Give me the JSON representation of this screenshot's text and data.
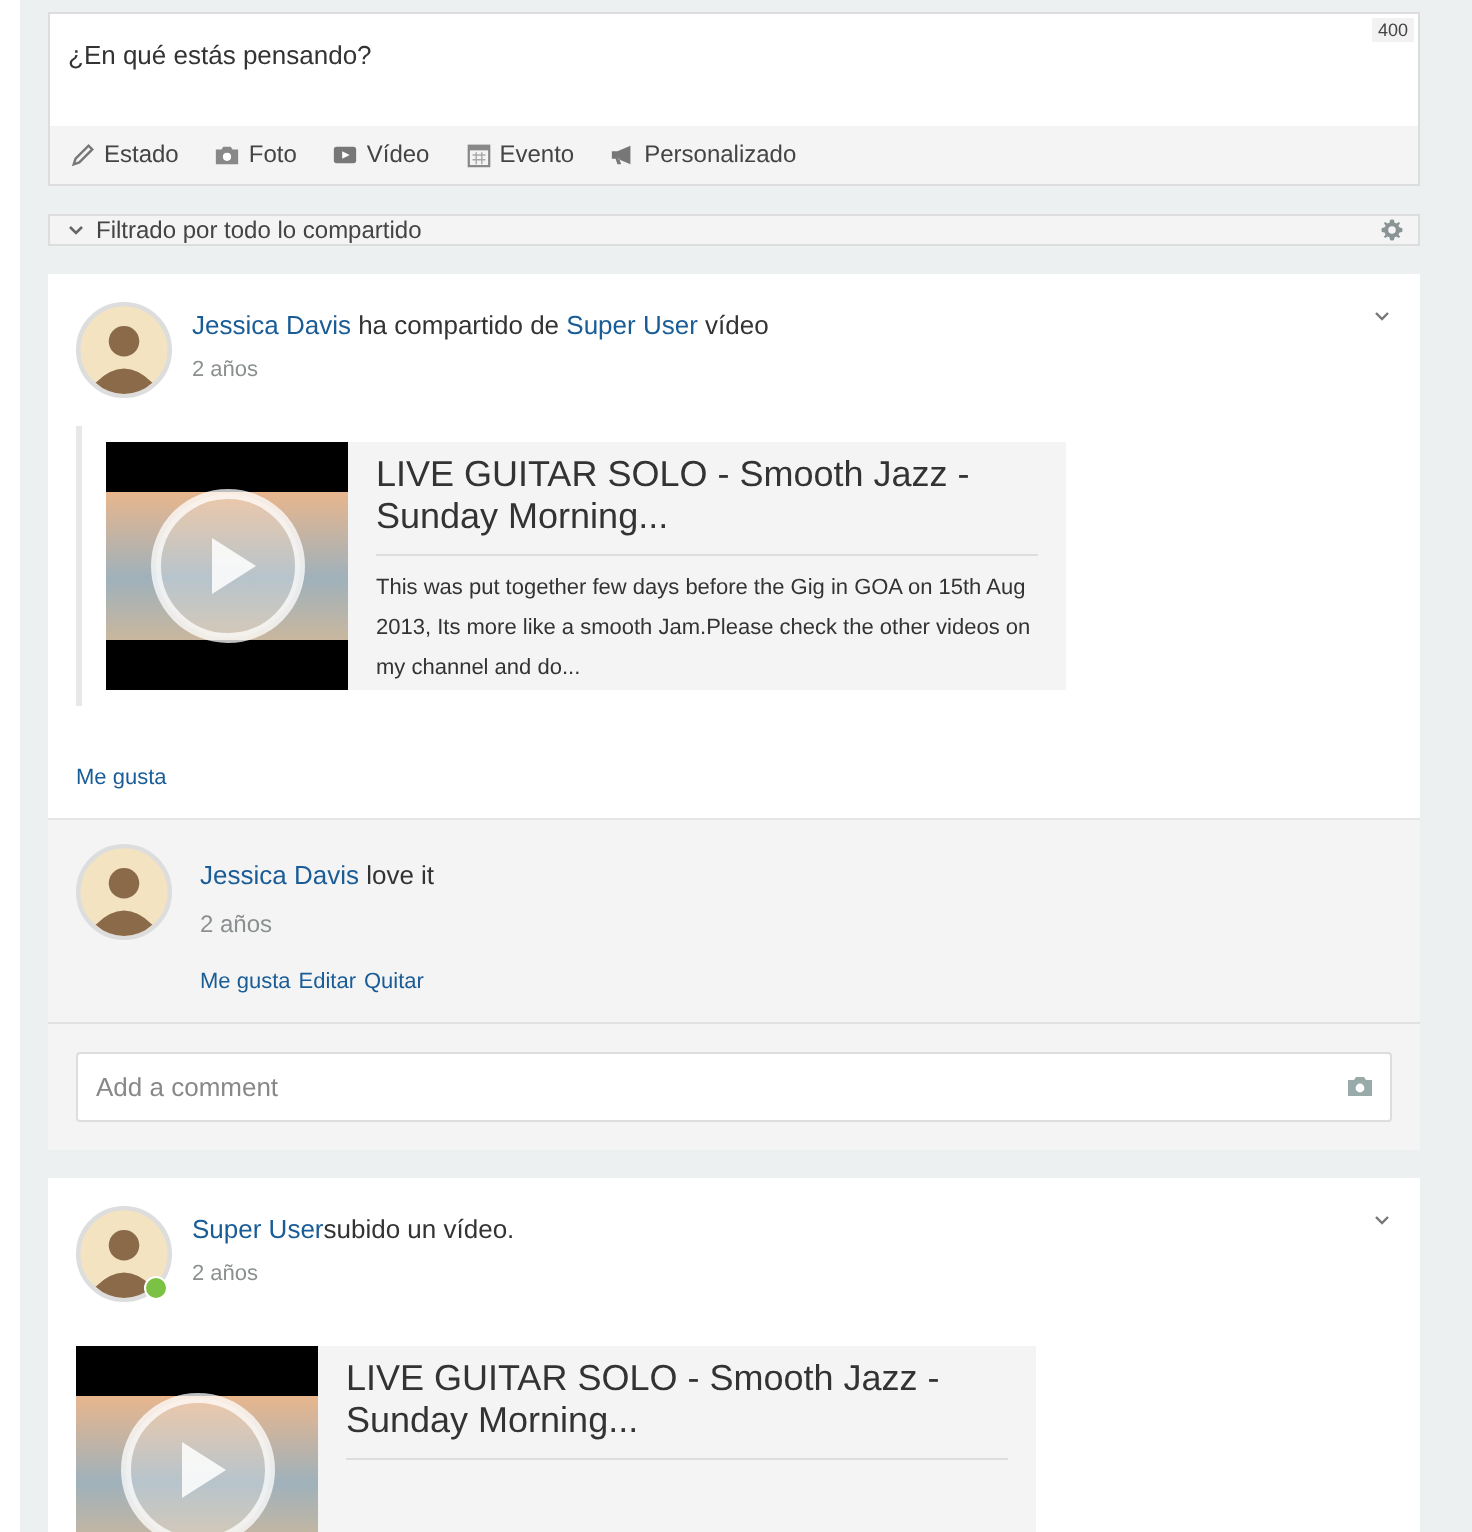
{
  "composer": {
    "placeholder": "¿En qué estás pensando?",
    "counter": "400",
    "actions": [
      {
        "kind": "status",
        "label": "Estado"
      },
      {
        "kind": "photo",
        "label": "Foto"
      },
      {
        "kind": "video",
        "label": "Vídeo"
      },
      {
        "kind": "event",
        "label": "Evento"
      },
      {
        "kind": "custom",
        "label": "Personalizado"
      }
    ]
  },
  "filter": {
    "label": "Filtrado por todo lo compartido"
  },
  "posts": [
    {
      "kind": "shared",
      "online": false,
      "headline": [
        {
          "kind": "link",
          "text": "Jessica Davis"
        },
        {
          "kind": "plain",
          "text": " ha compartido de "
        },
        {
          "kind": "link",
          "text": "Super User"
        },
        {
          "kind": "plain",
          "text": " vídeo"
        }
      ],
      "time": "2 años",
      "video": {
        "title": "LIVE GUITAR SOLO - Smooth Jazz - Sunday Morning...",
        "description": "This was put together few days before the Gig in GOA on 15th Aug 2013, Its more like a smooth Jam.Please check the other videos on my channel and do..."
      },
      "like": "Me gusta",
      "comments": [
        {
          "author": "Jessica Davis",
          "text": "love it",
          "time": "2 años",
          "actions": [
            "Me gusta",
            "Editar",
            "Quitar"
          ]
        }
      ],
      "comment_placeholder": "Add a comment"
    },
    {
      "kind": "upload",
      "online": true,
      "headline": [
        {
          "kind": "link",
          "text": "Super User"
        },
        {
          "kind": "plain",
          "text": "subido un vídeo."
        }
      ],
      "time": "2 años",
      "video": {
        "title": "LIVE GUITAR SOLO - Smooth Jazz - Sunday Morning..."
      }
    }
  ]
}
